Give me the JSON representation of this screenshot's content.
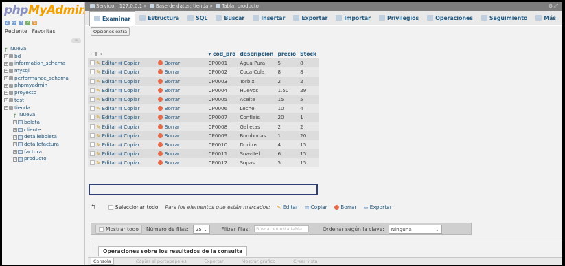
{
  "logo": {
    "part1": "php",
    "part2": "MyAdmin"
  },
  "left": {
    "tab_recent": "Reciente",
    "tab_fav": "Favoritas",
    "tree": [
      {
        "label": "Nueva",
        "indent": 0,
        "type": "new"
      },
      {
        "label": "bd",
        "indent": 0,
        "type": "db"
      },
      {
        "label": "information_schema",
        "indent": 0,
        "type": "db"
      },
      {
        "label": "mysql",
        "indent": 0,
        "type": "db"
      },
      {
        "label": "performance_schema",
        "indent": 0,
        "type": "db"
      },
      {
        "label": "phpmyadmin",
        "indent": 0,
        "type": "db"
      },
      {
        "label": "proyecto",
        "indent": 0,
        "type": "db"
      },
      {
        "label": "test",
        "indent": 0,
        "type": "db"
      },
      {
        "label": "tienda",
        "indent": 0,
        "type": "dbopen"
      },
      {
        "label": "Nueva",
        "indent": 1,
        "type": "new"
      },
      {
        "label": "boleta",
        "indent": 1,
        "type": "table"
      },
      {
        "label": "cliente",
        "indent": 1,
        "type": "table"
      },
      {
        "label": "detalleboleta",
        "indent": 1,
        "type": "table"
      },
      {
        "label": "detallefactura",
        "indent": 1,
        "type": "table"
      },
      {
        "label": "factura",
        "indent": 1,
        "type": "table"
      },
      {
        "label": "producto",
        "indent": 1,
        "type": "table"
      }
    ]
  },
  "breadcrumb": {
    "server": "Servidor: 127.0.0.1",
    "database": "Base de datos: tienda",
    "table": "Tabla: producto"
  },
  "tabs": [
    {
      "label": "Examinar",
      "active": true
    },
    {
      "label": "Estructura"
    },
    {
      "label": "SQL"
    },
    {
      "label": "Buscar"
    },
    {
      "label": "Insertar"
    },
    {
      "label": "Exportar"
    },
    {
      "label": "Importar"
    },
    {
      "label": "Privilegios"
    },
    {
      "label": "Operaciones"
    },
    {
      "label": "Seguimiento"
    },
    {
      "label": "Más"
    }
  ],
  "options_label": "Opciones extra",
  "grid": {
    "headers": {
      "sort_col": "cod_pro",
      "col2": "descripcion",
      "col3": "precio",
      "col4": "Stock"
    },
    "actions": {
      "edit": "Editar",
      "copy": "Copiar",
      "delete": "Borrar"
    },
    "rows": [
      {
        "cod": "CP0001",
        "desc": "Agua Pura",
        "price": "5",
        "stock": "8"
      },
      {
        "cod": "CP0002",
        "desc": "Coca Cola",
        "price": "8",
        "stock": "8"
      },
      {
        "cod": "CP0003",
        "desc": "Torbix",
        "price": "2",
        "stock": "2"
      },
      {
        "cod": "CP0004",
        "desc": "Huevos",
        "price": "1.50",
        "stock": "29"
      },
      {
        "cod": "CP0005",
        "desc": "Aceite",
        "price": "15",
        "stock": "5"
      },
      {
        "cod": "CP0006",
        "desc": "Leche",
        "price": "10",
        "stock": "4"
      },
      {
        "cod": "CP0007",
        "desc": "Confleis",
        "price": "20",
        "stock": "1"
      },
      {
        "cod": "CP0008",
        "desc": "Galletas",
        "price": "2",
        "stock": "2"
      },
      {
        "cod": "CP0009",
        "desc": "Bombonas",
        "price": "1",
        "stock": "20"
      },
      {
        "cod": "CP0010",
        "desc": "Doritos",
        "price": "4",
        "stock": "15"
      },
      {
        "cod": "CP0011",
        "desc": "Suavitel",
        "price": "6",
        "stock": "15"
      },
      {
        "cod": "CP0012",
        "desc": "Sopas",
        "price": "5",
        "stock": "15"
      }
    ]
  },
  "bulk": {
    "select_all": "Seleccionar todo",
    "note": "Para los elementos que están marcados:",
    "edit": "Editar",
    "copy": "Copiar",
    "delete": "Borrar",
    "export": "Exportar"
  },
  "nav": {
    "show_all": "Mostrar todo",
    "rows_label": "Número de filas:",
    "rows_value": "25",
    "filter_label": "Filtrar filas:",
    "filter_placeholder": "Buscar en esta tabla",
    "sort_label": "Ordenar según la clave:",
    "sort_value": "Ninguna"
  },
  "ops": {
    "legend": "Operaciones sobre los resultados de la consulta"
  },
  "console": {
    "label": "Consola",
    "item1": "Copiar al portapapeles",
    "item2": "Exportar",
    "item3": "Mostrar gráfico",
    "item4": "Crear vista"
  }
}
